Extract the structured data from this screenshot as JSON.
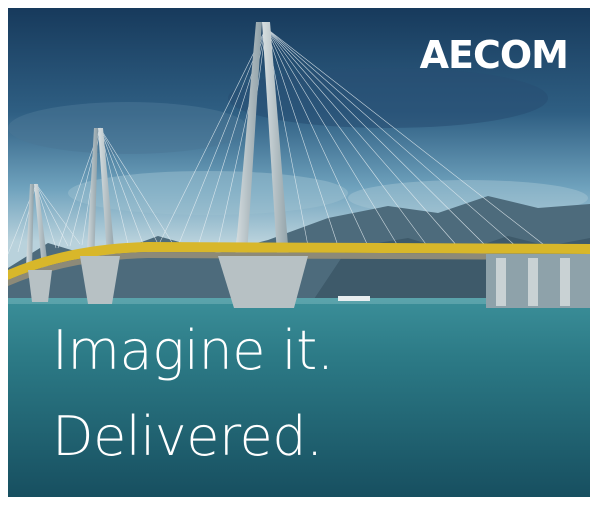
{
  "ad": {
    "brand": "AECOM",
    "tagline_line1": "Imagine it.",
    "tagline_line2": "Delivered."
  },
  "colors": {
    "sky_top": "#1b3f60",
    "sky_mid": "#6fa2bd",
    "water_top": "#2f7f8c",
    "water_bottom": "#1b5c6b",
    "bridge_deck": "#d8b72a",
    "text": "#ffffff"
  },
  "scene": {
    "subject": "cable-stayed bridge over water with mountains"
  }
}
